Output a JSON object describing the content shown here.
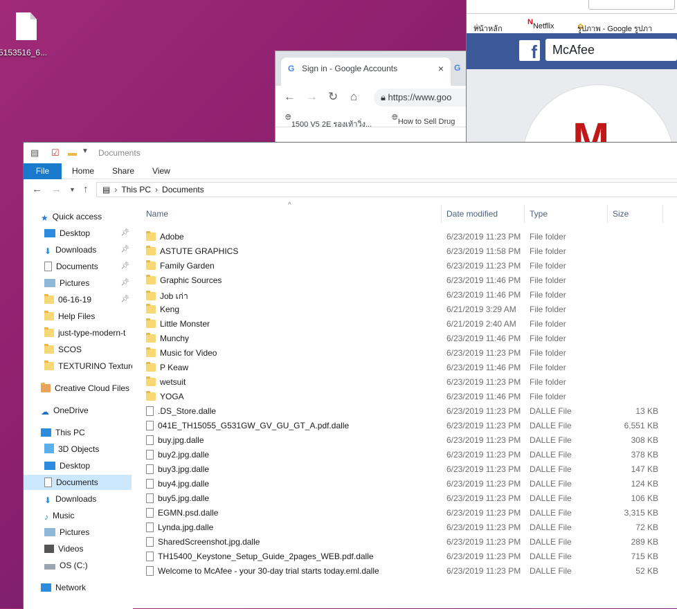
{
  "desktop": {
    "file_label": "5153516_6..."
  },
  "chrome": {
    "tab_title": "Sign in - Google Accounts",
    "tab_close": "×",
    "address": "https://www.goo",
    "bookmarks": [
      "1500 V5 2E รองเท้าวิ่ง...",
      "How to Sell Drug"
    ]
  },
  "facebook": {
    "bookmarks": [
      "หน้าหลัก",
      "Netflix",
      "รูปภาพ - Google รูปภา"
    ],
    "search_text": "McAfee",
    "logo": "f"
  },
  "explorer": {
    "title": "Documents",
    "ribbon_tabs": [
      "File",
      "Home",
      "Share",
      "View"
    ],
    "breadcrumb": [
      "This PC",
      "Documents"
    ],
    "columns": {
      "name": "Name",
      "date": "Date modified",
      "type": "Type",
      "size": "Size"
    },
    "nav": [
      "Quick access",
      "Desktop",
      "Downloads",
      "Documents",
      "Pictures",
      "06-16-19",
      "Help Files",
      "just-type-modern-t",
      "SCOS",
      "TEXTURINO Texture",
      "Creative Cloud Files",
      "OneDrive",
      "This PC",
      "3D Objects",
      "Desktop",
      "Documents",
      "Downloads",
      "Music",
      "Pictures",
      "Videos",
      "OS (C:)",
      "Network"
    ],
    "files": [
      {
        "name": "Adobe",
        "date": "6/23/2019 11:23 PM",
        "type": "File folder",
        "size": ""
      },
      {
        "name": "ASTUTE GRAPHICS",
        "date": "6/23/2019 11:58 PM",
        "type": "File folder",
        "size": ""
      },
      {
        "name": "Family Garden",
        "date": "6/23/2019 11:23 PM",
        "type": "File folder",
        "size": ""
      },
      {
        "name": "Graphic Sources",
        "date": "6/23/2019 11:46 PM",
        "type": "File folder",
        "size": ""
      },
      {
        "name": "Job เก่า",
        "date": "6/23/2019 11:46 PM",
        "type": "File folder",
        "size": ""
      },
      {
        "name": "Keng",
        "date": "6/21/2019 3:29 AM",
        "type": "File folder",
        "size": ""
      },
      {
        "name": "Little Monster",
        "date": "6/21/2019 2:40 AM",
        "type": "File folder",
        "size": ""
      },
      {
        "name": "Munchy",
        "date": "6/23/2019 11:46 PM",
        "type": "File folder",
        "size": ""
      },
      {
        "name": "Music for Video",
        "date": "6/23/2019 11:23 PM",
        "type": "File folder",
        "size": ""
      },
      {
        "name": "P Keaw",
        "date": "6/23/2019 11:46 PM",
        "type": "File folder",
        "size": ""
      },
      {
        "name": "wetsuit",
        "date": "6/23/2019 11:23 PM",
        "type": "File folder",
        "size": ""
      },
      {
        "name": "YOGA",
        "date": "6/23/2019 11:46 PM",
        "type": "File folder",
        "size": ""
      },
      {
        "name": ".DS_Store.dalle",
        "date": "6/23/2019 11:23 PM",
        "type": "DALLE File",
        "size": "13 KB"
      },
      {
        "name": "041E_TH15055_G531GW_GV_GU_GT_A.pdf.dalle",
        "date": "6/23/2019 11:23 PM",
        "type": "DALLE File",
        "size": "6,551 KB"
      },
      {
        "name": "buy.jpg.dalle",
        "date": "6/23/2019 11:23 PM",
        "type": "DALLE File",
        "size": "308 KB"
      },
      {
        "name": "buy2.jpg.dalle",
        "date": "6/23/2019 11:23 PM",
        "type": "DALLE File",
        "size": "378 KB"
      },
      {
        "name": "buy3.jpg.dalle",
        "date": "6/23/2019 11:23 PM",
        "type": "DALLE File",
        "size": "147 KB"
      },
      {
        "name": "buy4.jpg.dalle",
        "date": "6/23/2019 11:23 PM",
        "type": "DALLE File",
        "size": "124 KB"
      },
      {
        "name": "buy5.jpg.dalle",
        "date": "6/23/2019 11:23 PM",
        "type": "DALLE File",
        "size": "106 KB"
      },
      {
        "name": "EGMN.psd.dalle",
        "date": "6/23/2019 11:23 PM",
        "type": "DALLE File",
        "size": "3,315 KB"
      },
      {
        "name": "Lynda.jpg.dalle",
        "date": "6/23/2019 11:23 PM",
        "type": "DALLE File",
        "size": "72 KB"
      },
      {
        "name": "SharedScreenshot.jpg.dalle",
        "date": "6/23/2019 11:23 PM",
        "type": "DALLE File",
        "size": "289 KB"
      },
      {
        "name": "TH15400_Keystone_Setup_Guide_2pages_WEB.pdf.dalle",
        "date": "6/23/2019 11:23 PM",
        "type": "DALLE File",
        "size": "715 KB"
      },
      {
        "name": "Welcome to McAfee - your 30-day trial starts today.eml.dalle",
        "date": "6/23/2019 11:23 PM",
        "type": "DALLE File",
        "size": "52 KB"
      }
    ]
  }
}
